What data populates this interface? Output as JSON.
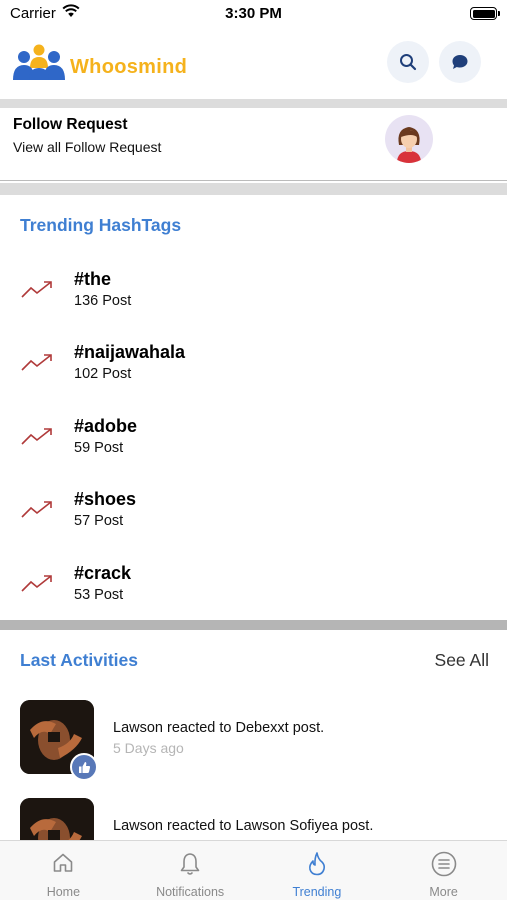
{
  "status_bar": {
    "carrier": "Carrier",
    "time": "3:30 PM"
  },
  "header": {
    "brand": "Whoosmind",
    "brand_color": "#f5b21c",
    "icons": [
      "search-icon",
      "chat-icon"
    ]
  },
  "follow_request": {
    "title": "Follow Request",
    "subtitle": "View all Follow Request"
  },
  "trending": {
    "title": "Trending HashTags",
    "items": [
      {
        "tag": "#the",
        "count": "136 Post"
      },
      {
        "tag": "#naijawahala",
        "count": "102 Post"
      },
      {
        "tag": "#adobe",
        "count": "59 Post"
      },
      {
        "tag": "#shoes",
        "count": "57 Post"
      },
      {
        "tag": "#crack",
        "count": "53 Post"
      }
    ]
  },
  "activities": {
    "title": "Last Activities",
    "see_all": "See All",
    "items": [
      {
        "text": "Lawson reacted to Debexxt post.",
        "time": "5 Days ago"
      },
      {
        "text": "Lawson reacted to Lawson Sofiyea post.",
        "time": ""
      }
    ]
  },
  "tabbar": {
    "tabs": [
      {
        "label": "Home",
        "icon": "home-icon"
      },
      {
        "label": "Notifications",
        "icon": "bell-icon"
      },
      {
        "label": "Trending",
        "icon": "flame-icon",
        "active": true
      },
      {
        "label": "More",
        "icon": "menu-icon"
      }
    ]
  },
  "colors": {
    "accent": "#3f7fd2",
    "trend_icon": "#b03a3a",
    "divider": "#dcdcdc"
  }
}
